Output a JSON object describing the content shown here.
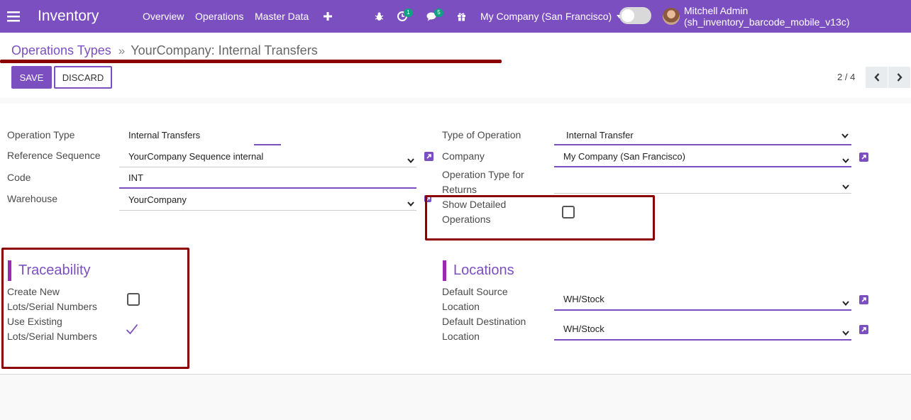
{
  "navbar": {
    "app_name": "Inventory",
    "menu": [
      "Overview",
      "Operations",
      "Master Data"
    ],
    "plus_icon": "plus-icon",
    "activity_badge": "1",
    "messages_badge": "5",
    "company": "My Company (San Francisco)",
    "user": "Mitchell Admin (sh_inventory_barcode_mobile_v13c)"
  },
  "breadcrumb": {
    "parent": "Operations Types",
    "current": "YourCompany: Internal Transfers"
  },
  "buttons": {
    "save": "SAVE",
    "discard": "DISCARD"
  },
  "pager": {
    "text": "2 / 4"
  },
  "form": {
    "left": {
      "operation_type_label": "Operation Type",
      "operation_type_value": "Internal Transfers",
      "reference_sequence_label": "Reference Sequence",
      "reference_sequence_value": "YourCompany Sequence internal",
      "code_label": "Code",
      "code_value": "INT",
      "warehouse_label": "Warehouse",
      "warehouse_value": "YourCompany"
    },
    "right": {
      "type_of_operation_label": "Type of Operation",
      "type_of_operation_value": "Internal Transfer",
      "company_label": "Company",
      "company_value": "My Company (San Francisco)",
      "return_type_label_1": "Operation Type for",
      "return_type_label_2": "Returns",
      "return_type_value": "",
      "show_detailed_label_1": "Show Detailed",
      "show_detailed_label_2": "Operations",
      "show_detailed_checked": false
    },
    "traceability": {
      "title": "Traceability",
      "create_lots_label_1": "Create New",
      "create_lots_label_2": "Lots/Serial Numbers",
      "create_lots_checked": false,
      "use_existing_label_1": "Use Existing",
      "use_existing_label_2": "Lots/Serial Numbers",
      "use_existing_checked": true
    },
    "locations": {
      "title": "Locations",
      "source_label_1": "Default Source",
      "source_label_2": "Location",
      "source_value": "WH/Stock",
      "dest_label_1": "Default Destination",
      "dest_label_2": "Location",
      "dest_value": "WH/Stock"
    }
  },
  "colors": {
    "primary": "#7c4fc1",
    "highlight_box": "#8b0000",
    "badge": "#11a082"
  }
}
